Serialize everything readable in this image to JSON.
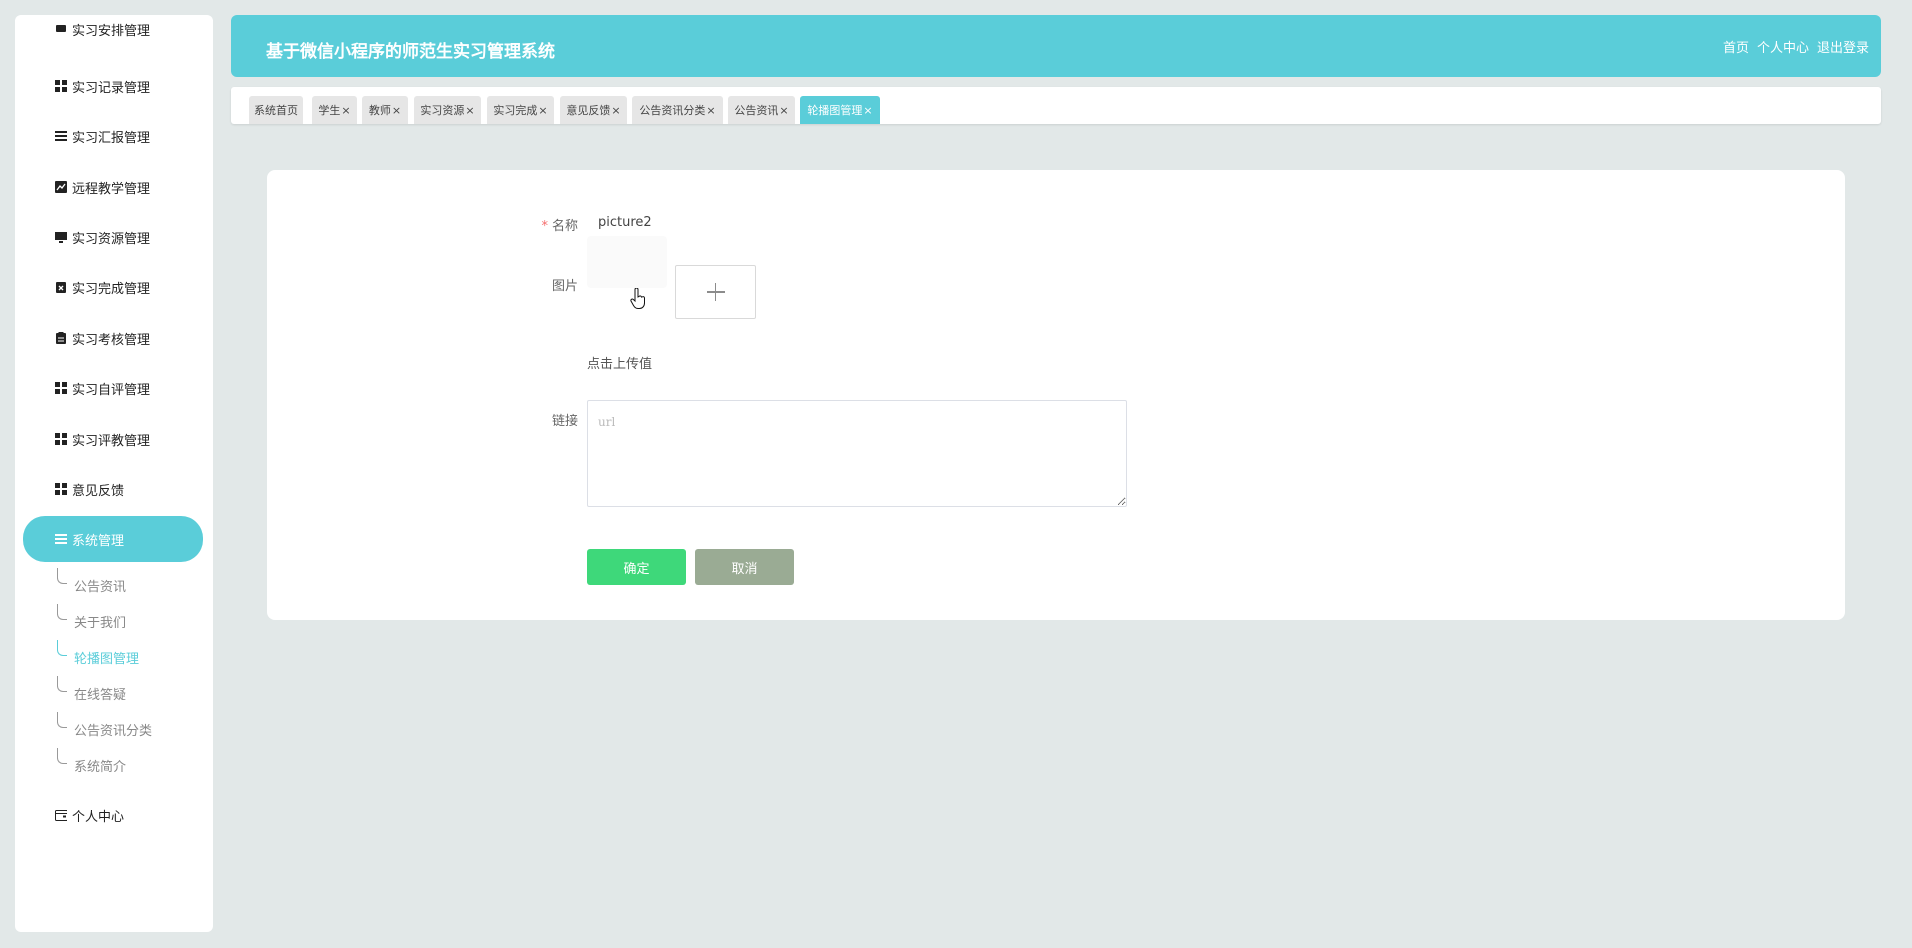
{
  "sidebar": {
    "items": [
      {
        "label": "实习安排管理",
        "icon": "card-icon"
      },
      {
        "label": "实习记录管理",
        "icon": "grid-icon"
      },
      {
        "label": "实习汇报管理",
        "icon": "list-icon"
      },
      {
        "label": "远程教学管理",
        "icon": "chart-icon"
      },
      {
        "label": "实习资源管理",
        "icon": "monitor-icon"
      },
      {
        "label": "实习完成管理",
        "icon": "clipboard-x-icon"
      },
      {
        "label": "实习考核管理",
        "icon": "clipboard-icon"
      },
      {
        "label": "实习自评管理",
        "icon": "grid-icon"
      },
      {
        "label": "实习评教管理",
        "icon": "grid-icon"
      },
      {
        "label": "意见反馈",
        "icon": "grid-icon"
      },
      {
        "label": "系统管理",
        "icon": "list-icon"
      }
    ],
    "sub_items": [
      "公告资讯",
      "关于我们",
      "轮播图管理",
      "在线答疑",
      "公告资讯分类",
      "系统简介"
    ],
    "personal": "个人中心"
  },
  "header": {
    "title": "基于微信小程序的师范生实习管理系统",
    "links": [
      "首页",
      "个人中心",
      "退出登录"
    ]
  },
  "tabs": [
    "系统首页",
    "学生",
    "教师",
    "实习资源",
    "实习完成",
    "意见反馈",
    "公告资讯分类",
    "公告资讯",
    "轮播图管理"
  ],
  "tab_close": "×",
  "form": {
    "name_label": "名称",
    "required_mark": "*",
    "name_value": "picture2",
    "image_label": "图片",
    "upload_hint": "点击上传值",
    "link_label": "链接",
    "link_placeholder": "url",
    "link_value": "",
    "ok_label": "确定",
    "cancel_label": "取消"
  },
  "colors": {
    "accent": "#5acdd9",
    "confirm": "#3ed87a",
    "cancel": "#9aab94",
    "background": "#e2e8e8"
  }
}
